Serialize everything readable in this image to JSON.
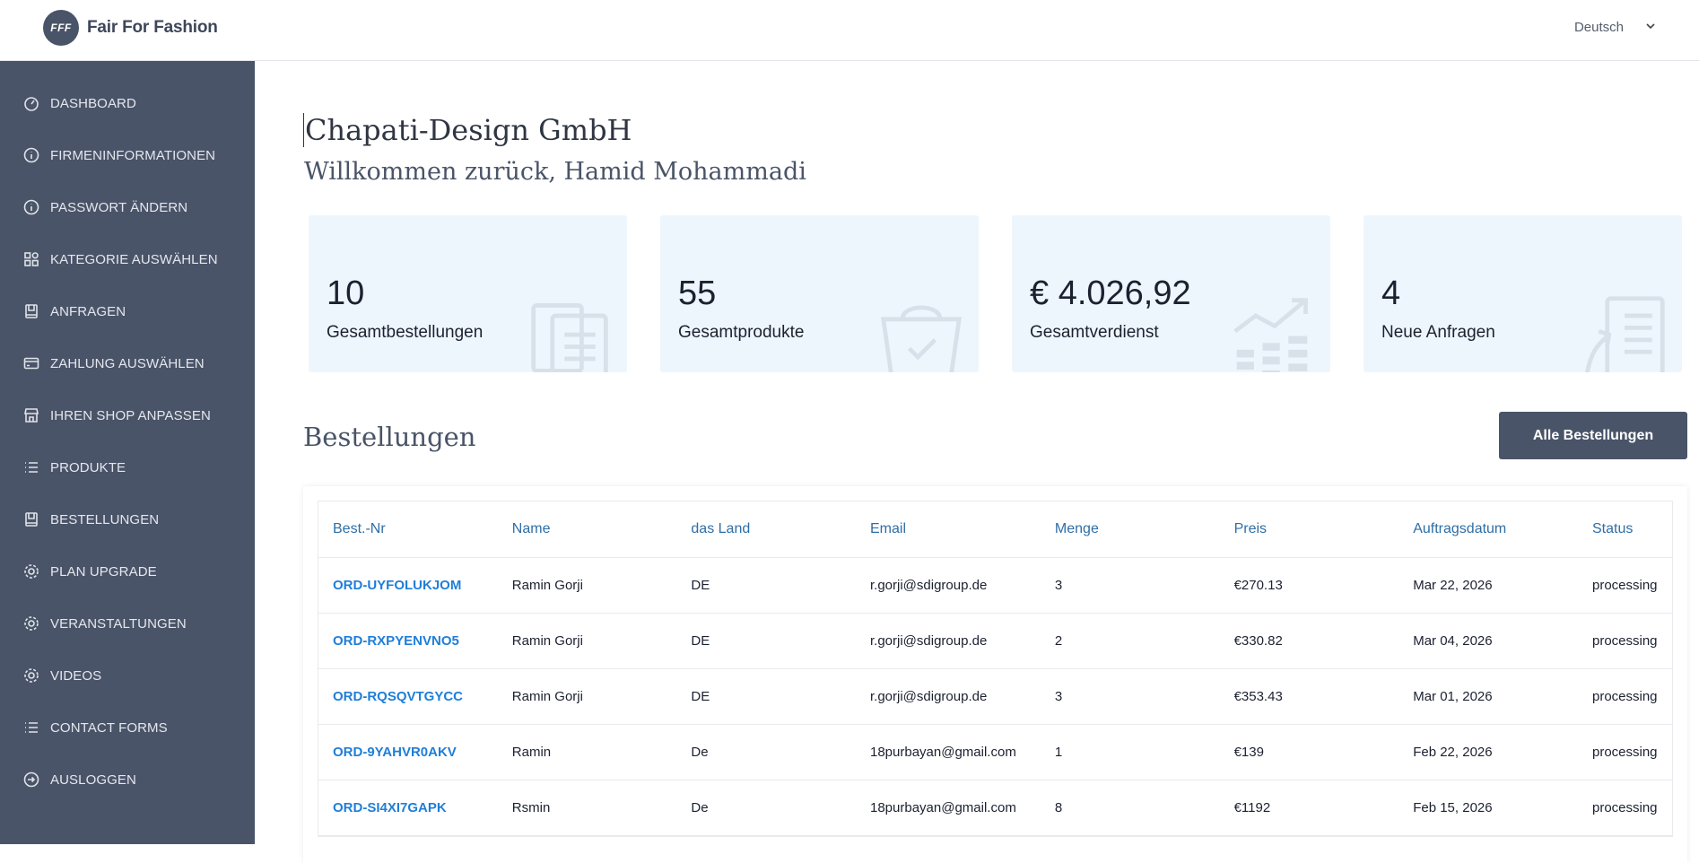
{
  "header": {
    "logo_badge": "FFF",
    "logo_text": "Fair For Fashion",
    "language": "Deutsch"
  },
  "sidebar": {
    "items": [
      {
        "label": "DASHBOARD",
        "icon": "gauge-icon"
      },
      {
        "label": "FIRMENINFORMATIONEN",
        "icon": "info-icon"
      },
      {
        "label": "PASSWORT ÄNDERN",
        "icon": "info-icon"
      },
      {
        "label": "KATEGORIE AUSWÄHLEN",
        "icon": "grid-icon"
      },
      {
        "label": "ANFRAGEN",
        "icon": "inbox-icon"
      },
      {
        "label": "ZAHLUNG AUSWÄHLEN",
        "icon": "card-icon"
      },
      {
        "label": "IHREN SHOP ANPASSEN",
        "icon": "store-icon"
      },
      {
        "label": "PRODUKTE",
        "icon": "list-icon"
      },
      {
        "label": "BESTELLUNGEN",
        "icon": "inbox-icon"
      },
      {
        "label": "PLAN UPGRADE",
        "icon": "gear-icon"
      },
      {
        "label": "VERANSTALTUNGEN",
        "icon": "gear-icon"
      },
      {
        "label": "VIDEOS",
        "icon": "gear-icon"
      },
      {
        "label": "CONTACT FORMS",
        "icon": "list-icon"
      },
      {
        "label": "AUSLOGGEN",
        "icon": "logout-icon"
      }
    ]
  },
  "main": {
    "company": "Chapati-Design GmbH",
    "welcome": "Willkommen zurück, Hamid Mohammadi",
    "stats": [
      {
        "value": "10",
        "label": "Gesamtbestellungen",
        "icon": "documents-icon"
      },
      {
        "value": "55",
        "label": "Gesamtprodukte",
        "icon": "basket-icon"
      },
      {
        "value": "€ 4.026,92",
        "label": "Gesamtverdienst",
        "icon": "growth-chart-icon"
      },
      {
        "value": "4",
        "label": "Neue Anfragen",
        "icon": "report-icon"
      }
    ],
    "orders_title": "Bestellungen",
    "all_orders_button": "Alle Bestellungen",
    "table": {
      "columns": [
        "Best.-Nr",
        "Name",
        "das Land",
        "Email",
        "Menge",
        "Preis",
        "Auftragsdatum",
        "Status"
      ],
      "rows": [
        [
          "ORD-UYFOLUKJOM",
          "Ramin Gorji",
          "DE",
          "r.gorji@sdigroup.de",
          "3",
          "€270.13",
          "Mar 22, 2026",
          "processing"
        ],
        [
          "ORD-RXPYENVNO5",
          "Ramin Gorji",
          "DE",
          "r.gorji@sdigroup.de",
          "2",
          "€330.82",
          "Mar 04, 2026",
          "processing"
        ],
        [
          "ORD-RQSQVTGYCC",
          "Ramin Gorji",
          "DE",
          "r.gorji@sdigroup.de",
          "3",
          "€353.43",
          "Mar 01, 2026",
          "processing"
        ],
        [
          "ORD-9YAHVR0AKV",
          "Ramin",
          "De",
          "18purbayan@gmail.com",
          "1",
          "€139",
          "Feb 22, 2026",
          "processing"
        ],
        [
          "ORD-SI4XI7GAPK",
          "Rsmin",
          "De",
          "18purbayan@gmail.com",
          "8",
          "€1192",
          "Feb 15, 2026",
          "processing"
        ]
      ]
    }
  },
  "colors": {
    "sidebar_bg": "#4a5468",
    "stat_bg": "#eef6fd",
    "link": "#1f7ed8",
    "header_text": "#2f6ea6"
  }
}
